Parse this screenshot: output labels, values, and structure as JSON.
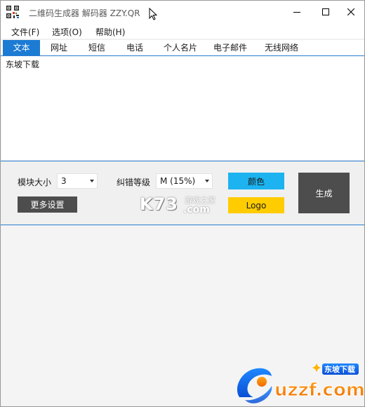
{
  "window": {
    "title": "二维码生成器 解码器 ZZY.QR"
  },
  "menu": [
    "文件(F)",
    "选项(O)",
    "帮助(H)"
  ],
  "tabs": [
    {
      "label": "文本",
      "active": true
    },
    {
      "label": "网址",
      "active": false
    },
    {
      "label": "短信",
      "active": false
    },
    {
      "label": "电话",
      "active": false
    },
    {
      "label": "个人名片",
      "active": false
    },
    {
      "label": "电子邮件",
      "active": false
    },
    {
      "label": "无线网络",
      "active": false
    }
  ],
  "text_input": {
    "value": "东坡下载"
  },
  "controls": {
    "module_size_label": "模块大小",
    "module_size_value": "3",
    "error_level_label": "纠错等级",
    "error_level_value": "M (15%)",
    "more_settings": "更多设置",
    "color_button": "颜色",
    "logo_button": "Logo",
    "generate_button": "生成"
  },
  "watermarks": {
    "k73": "K73",
    "k73_sub": "游戏之家",
    "k73_com": ".com",
    "uzzf": "uzzf.com",
    "uzzf_badge": "东坡下载"
  },
  "colors": {
    "accent": "#1c7bd3",
    "color_button": "#1cb3f0",
    "logo_button": "#ffcc00",
    "dark_button": "#4d4d4d"
  }
}
